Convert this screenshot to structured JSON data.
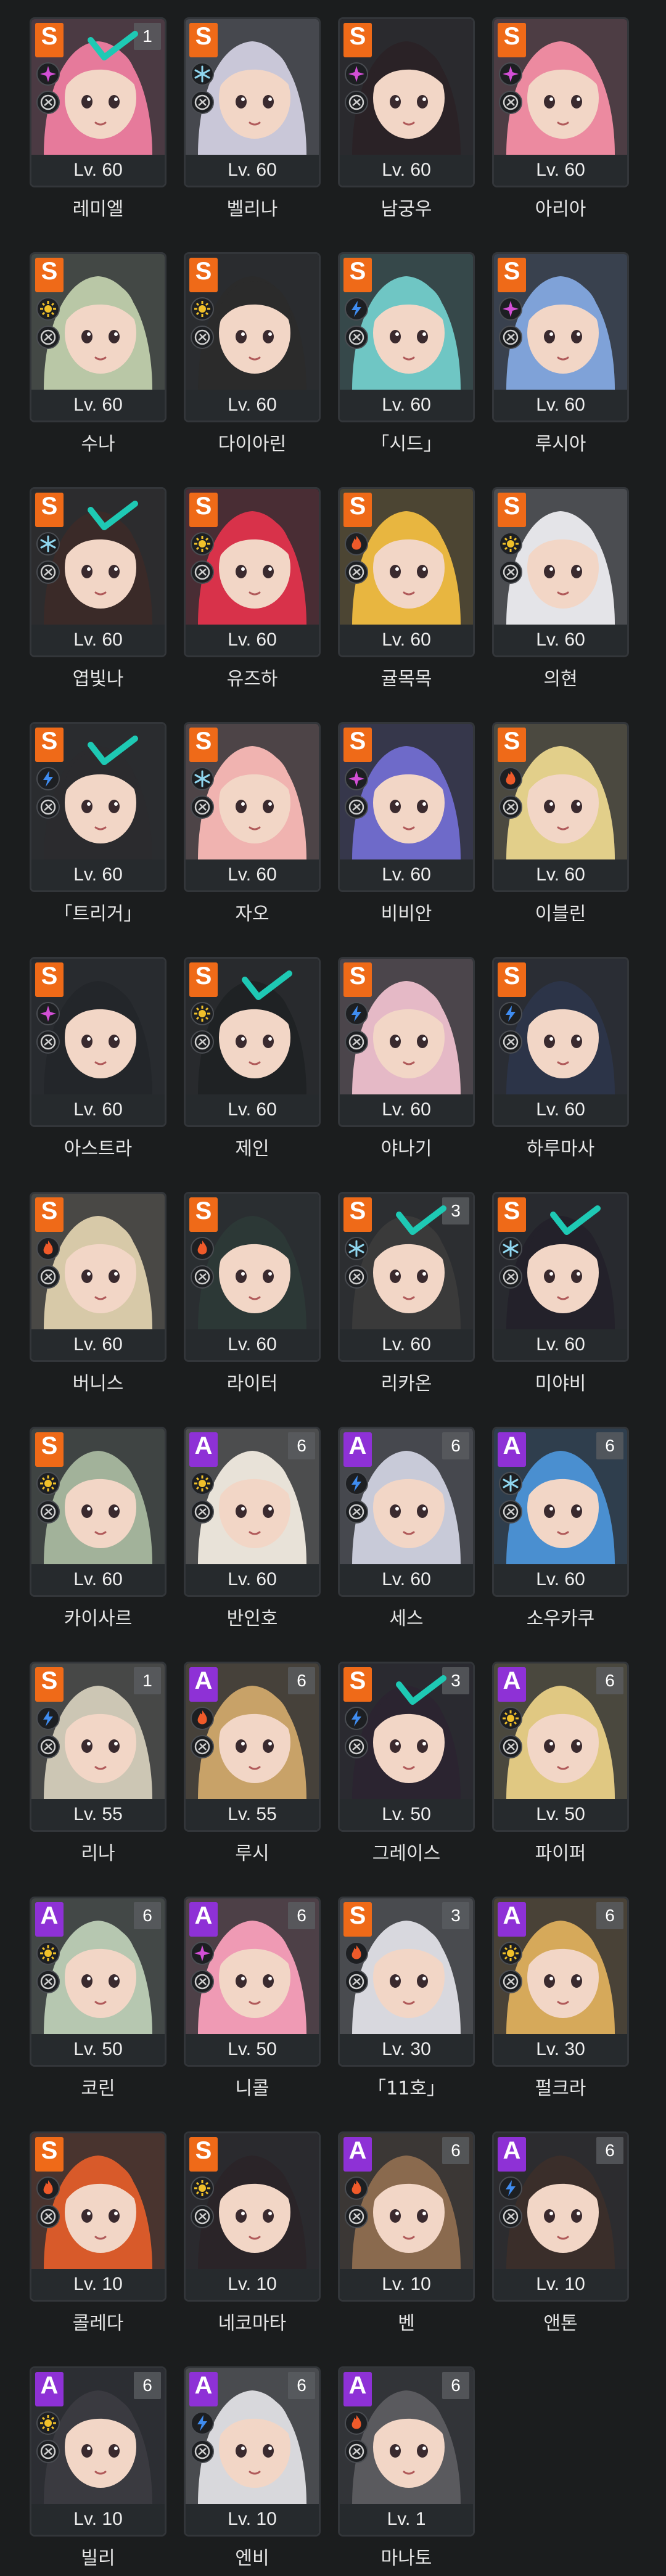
{
  "colors": {
    "background": "#1b1d1e",
    "rank_S": "#ef6a18",
    "rank_A": "#8e31d6",
    "check": "#1ec9b4"
  },
  "agents": [
    {
      "name": "레미엘",
      "level": "Lv. 60",
      "rank": "S",
      "count": "1",
      "attribute": "ether",
      "checked": true
    },
    {
      "name": "벨리나",
      "level": "Lv. 60",
      "rank": "S",
      "count": "",
      "attribute": "ice",
      "checked": false
    },
    {
      "name": "남궁우",
      "level": "Lv. 60",
      "rank": "S",
      "count": "",
      "attribute": "ether",
      "checked": false
    },
    {
      "name": "아리아",
      "level": "Lv. 60",
      "rank": "S",
      "count": "",
      "attribute": "ether",
      "checked": false
    },
    {
      "name": "수나",
      "level": "Lv. 60",
      "rank": "S",
      "count": "",
      "attribute": "physical",
      "checked": false
    },
    {
      "name": "다이아린",
      "level": "Lv. 60",
      "rank": "S",
      "count": "",
      "attribute": "physical",
      "checked": false
    },
    {
      "name": "「시드」",
      "level": "Lv. 60",
      "rank": "S",
      "count": "",
      "attribute": "electric",
      "checked": false
    },
    {
      "name": "루시아",
      "level": "Lv. 60",
      "rank": "S",
      "count": "",
      "attribute": "ether",
      "checked": false
    },
    {
      "name": "엽빛나",
      "level": "Lv. 60",
      "rank": "S",
      "count": "",
      "attribute": "ice",
      "checked": true
    },
    {
      "name": "유즈하",
      "level": "Lv. 60",
      "rank": "S",
      "count": "",
      "attribute": "physical",
      "checked": false
    },
    {
      "name": "귤목목",
      "level": "Lv. 60",
      "rank": "S",
      "count": "",
      "attribute": "fire",
      "checked": false
    },
    {
      "name": "의현",
      "level": "Lv. 60",
      "rank": "S",
      "count": "",
      "attribute": "physical",
      "checked": false
    },
    {
      "name": "「트리거」",
      "level": "Lv. 60",
      "rank": "S",
      "count": "",
      "attribute": "electric",
      "checked": true
    },
    {
      "name": "자오",
      "level": "Lv. 60",
      "rank": "S",
      "count": "",
      "attribute": "ice",
      "checked": false
    },
    {
      "name": "비비안",
      "level": "Lv. 60",
      "rank": "S",
      "count": "",
      "attribute": "ether",
      "checked": false
    },
    {
      "name": "이블린",
      "level": "Lv. 60",
      "rank": "S",
      "count": "",
      "attribute": "fire",
      "checked": false
    },
    {
      "name": "아스트라",
      "level": "Lv. 60",
      "rank": "S",
      "count": "",
      "attribute": "ether",
      "checked": false
    },
    {
      "name": "제인",
      "level": "Lv. 60",
      "rank": "S",
      "count": "",
      "attribute": "physical",
      "checked": true
    },
    {
      "name": "야나기",
      "level": "Lv. 60",
      "rank": "S",
      "count": "",
      "attribute": "electric",
      "checked": false
    },
    {
      "name": "하루마사",
      "level": "Lv. 60",
      "rank": "S",
      "count": "",
      "attribute": "electric",
      "checked": false
    },
    {
      "name": "버니스",
      "level": "Lv. 60",
      "rank": "S",
      "count": "",
      "attribute": "fire",
      "checked": false
    },
    {
      "name": "라이터",
      "level": "Lv. 60",
      "rank": "S",
      "count": "",
      "attribute": "fire",
      "checked": false
    },
    {
      "name": "리카온",
      "level": "Lv. 60",
      "rank": "S",
      "count": "3",
      "attribute": "ice",
      "checked": true
    },
    {
      "name": "미야비",
      "level": "Lv. 60",
      "rank": "S",
      "count": "",
      "attribute": "ice",
      "checked": true
    },
    {
      "name": "카이사르",
      "level": "Lv. 60",
      "rank": "S",
      "count": "",
      "attribute": "physical",
      "checked": false
    },
    {
      "name": "반인호",
      "level": "Lv. 60",
      "rank": "A",
      "count": "6",
      "attribute": "physical",
      "checked": false
    },
    {
      "name": "세스",
      "level": "Lv. 60",
      "rank": "A",
      "count": "6",
      "attribute": "electric",
      "checked": false
    },
    {
      "name": "소우카쿠",
      "level": "Lv. 60",
      "rank": "A",
      "count": "6",
      "attribute": "ice",
      "checked": false
    },
    {
      "name": "리나",
      "level": "Lv. 55",
      "rank": "S",
      "count": "1",
      "attribute": "electric",
      "checked": false
    },
    {
      "name": "루시",
      "level": "Lv. 55",
      "rank": "A",
      "count": "6",
      "attribute": "fire",
      "checked": false
    },
    {
      "name": "그레이스",
      "level": "Lv. 50",
      "rank": "S",
      "count": "3",
      "attribute": "electric",
      "checked": true
    },
    {
      "name": "파이퍼",
      "level": "Lv. 50",
      "rank": "A",
      "count": "6",
      "attribute": "physical",
      "checked": false
    },
    {
      "name": "코린",
      "level": "Lv. 50",
      "rank": "A",
      "count": "6",
      "attribute": "physical",
      "checked": false
    },
    {
      "name": "니콜",
      "level": "Lv. 50",
      "rank": "A",
      "count": "6",
      "attribute": "ether",
      "checked": false
    },
    {
      "name": "「11호」",
      "level": "Lv. 30",
      "rank": "S",
      "count": "3",
      "attribute": "fire",
      "checked": false
    },
    {
      "name": "펄크라",
      "level": "Lv. 30",
      "rank": "A",
      "count": "6",
      "attribute": "physical",
      "checked": false
    },
    {
      "name": "콜레다",
      "level": "Lv. 10",
      "rank": "S",
      "count": "",
      "attribute": "fire",
      "checked": false
    },
    {
      "name": "네코마타",
      "level": "Lv. 10",
      "rank": "S",
      "count": "",
      "attribute": "physical",
      "checked": false
    },
    {
      "name": "벤",
      "level": "Lv. 10",
      "rank": "A",
      "count": "6",
      "attribute": "fire",
      "checked": false
    },
    {
      "name": "앤톤",
      "level": "Lv. 10",
      "rank": "A",
      "count": "6",
      "attribute": "electric",
      "checked": false
    },
    {
      "name": "빌리",
      "level": "Lv. 10",
      "rank": "A",
      "count": "6",
      "attribute": "physical",
      "checked": false
    },
    {
      "name": "엔비",
      "level": "Lv. 10",
      "rank": "A",
      "count": "6",
      "attribute": "electric",
      "checked": false
    },
    {
      "name": "마나토",
      "level": "Lv. 1",
      "rank": "A",
      "count": "6",
      "attribute": "fire",
      "checked": false
    }
  ]
}
